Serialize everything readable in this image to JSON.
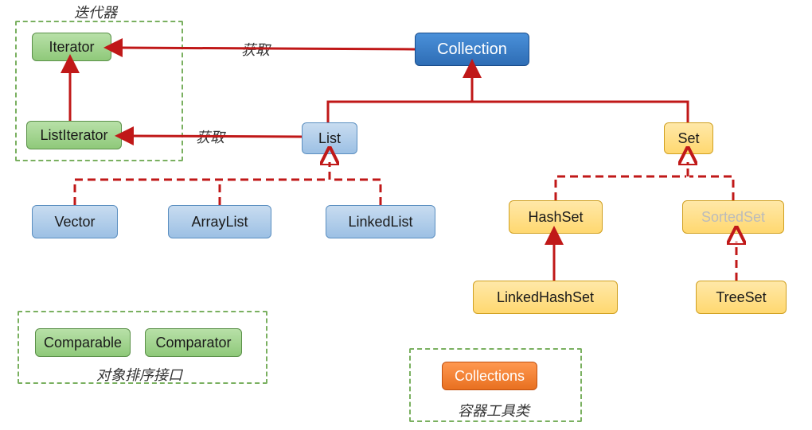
{
  "nodes": {
    "iterator": "Iterator",
    "listIterator": "ListIterator",
    "collection": "Collection",
    "list": "List",
    "set": "Set",
    "vector": "Vector",
    "arrayList": "ArrayList",
    "linkedList": "LinkedList",
    "hashSet": "HashSet",
    "sortedSet": "SortedSet",
    "linkedHashSet": "LinkedHashSet",
    "treeSet": "TreeSet",
    "comparable": "Comparable",
    "comparator": "Comparator",
    "collections": "Collections"
  },
  "labels": {
    "iteratorGroup": "迭代器",
    "obtain1": "获取",
    "obtain2": "获取",
    "sortInterface": "对象排序接口",
    "utilClass": "容器工具类"
  },
  "colors": {
    "red": "#c01818",
    "green": "#7ab060"
  }
}
